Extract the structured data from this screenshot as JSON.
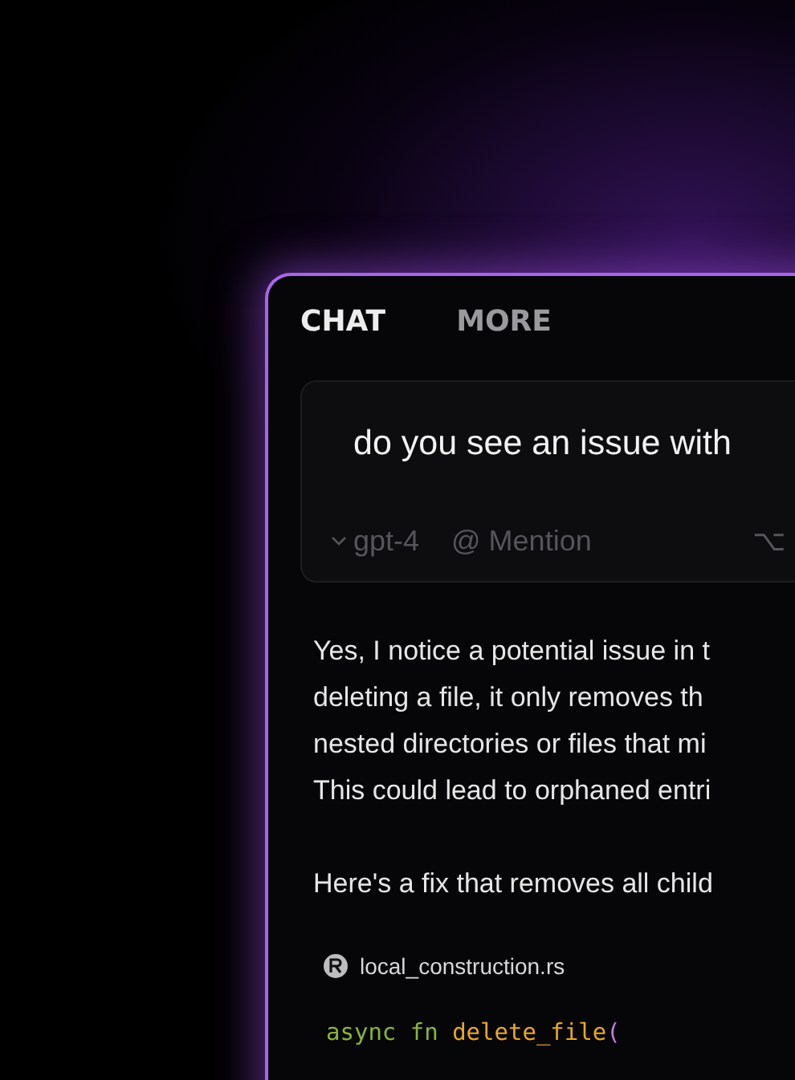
{
  "tabs": [
    {
      "label": "CHAT",
      "selected": true
    },
    {
      "label": "MORE",
      "selected": false
    }
  ],
  "composer": {
    "value": "do you see an issue with",
    "model": "gpt-4",
    "mention": "@ Mention",
    "shortcut": "⌥"
  },
  "response": {
    "paragraphs": [
      [
        "Yes, I notice a potential issue in t",
        "deleting a file, it only removes th",
        "nested directories or files that mi",
        "This could lead to orphaned entri"
      ],
      [
        "Here's a fix that removes all child"
      ]
    ]
  },
  "code_block": {
    "filename": "local_construction.rs",
    "tokens": [
      {
        "text": "async fn",
        "color": "#86b53a"
      },
      {
        "text": "delete_file",
        "color": "#e8a825"
      },
      {
        "text": "(",
        "color": "#c678dd"
      }
    ]
  }
}
